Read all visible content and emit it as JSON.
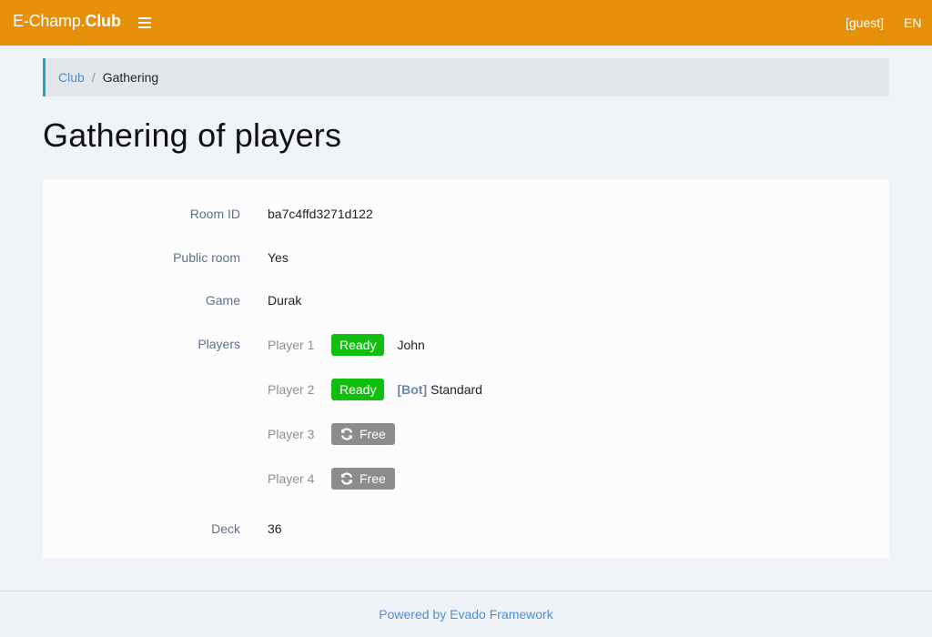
{
  "header": {
    "brand_light": "E-Champ.",
    "brand_bold": "Club",
    "user": "[guest]",
    "lang": "EN",
    "menu_icon": "hamburger-icon",
    "bg_color": "#e6900a"
  },
  "breadcrumb": {
    "home": "Club",
    "separator": "/",
    "current": "Gathering"
  },
  "page": {
    "title": "Gathering of players"
  },
  "details": {
    "room_id_label": "Room ID",
    "room_id_value": "ba7c4ffd3271d122",
    "public_label": "Public room",
    "public_value": "Yes",
    "game_label": "Game",
    "game_value": "Durak",
    "players_label": "Players",
    "deck_label": "Deck",
    "deck_value": "36"
  },
  "players": [
    {
      "slot": "Player 1",
      "status": "Ready",
      "bot_tag": "",
      "name": "John"
    },
    {
      "slot": "Player 2",
      "status": "Ready",
      "bot_tag": "[Bot]",
      "name": "Standard"
    },
    {
      "slot": "Player 3",
      "status": "Free",
      "status_icon": "refresh-icon",
      "name": ""
    },
    {
      "slot": "Player 4",
      "status": "Free",
      "status_icon": "refresh-icon",
      "name": ""
    }
  ],
  "colors": {
    "ready": "#11bf11",
    "free": "#8d8d8d",
    "accent": "#20a8b8",
    "link": "#4a8fd8"
  },
  "footer": {
    "text": "Powered by Evado Framework"
  }
}
